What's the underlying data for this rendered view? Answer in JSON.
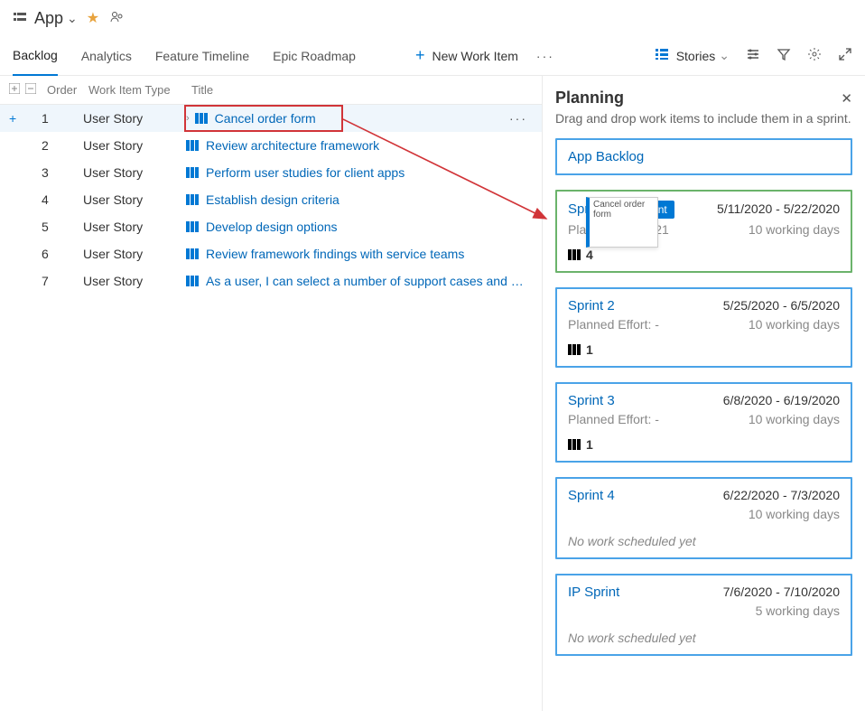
{
  "header": {
    "title": "App"
  },
  "tabs": {
    "backlog": "Backlog",
    "analytics": "Analytics",
    "feature": "Feature Timeline",
    "epic": "Epic Roadmap",
    "newWorkItem": "New Work Item",
    "storiesLabel": "Stories"
  },
  "grid": {
    "cols": {
      "order": "Order",
      "type": "Work Item Type",
      "title": "Title"
    },
    "rows": [
      {
        "order": "1",
        "type": "User Story",
        "title": "Cancel order form"
      },
      {
        "order": "2",
        "type": "User Story",
        "title": "Review architecture framework"
      },
      {
        "order": "3",
        "type": "User Story",
        "title": "Perform user studies for client apps"
      },
      {
        "order": "4",
        "type": "User Story",
        "title": "Establish design criteria"
      },
      {
        "order": "5",
        "type": "User Story",
        "title": "Develop design options"
      },
      {
        "order": "6",
        "type": "User Story",
        "title": "Review framework findings with service teams"
      },
      {
        "order": "7",
        "type": "User Story",
        "title": "As a user, I can select a number of support cases and …"
      }
    ]
  },
  "panel": {
    "title": "Planning",
    "sub": "Drag and drop work items to include them in a sprint.",
    "backlogName": "App Backlog",
    "currentBadge": "Current",
    "sprints": [
      {
        "name": "Sprint 1",
        "dates": "5/11/2020 - 5/22/2020",
        "effort": "Planned Effort: 21",
        "days": "10 working days",
        "count": "4",
        "current": true,
        "ghost": "Cancel order form"
      },
      {
        "name": "Sprint 2",
        "dates": "5/25/2020 - 6/5/2020",
        "effort": "Planned Effort: -",
        "days": "10 working days",
        "count": "1"
      },
      {
        "name": "Sprint 3",
        "dates": "6/8/2020 - 6/19/2020",
        "effort": "Planned Effort: -",
        "days": "10 working days",
        "count": "1"
      },
      {
        "name": "Sprint 4",
        "dates": "6/22/2020 - 7/3/2020",
        "days": "10 working days",
        "none": "No work scheduled yet"
      },
      {
        "name": "IP Sprint",
        "dates": "7/6/2020 - 7/10/2020",
        "days": "5 working days",
        "none": "No work scheduled yet"
      }
    ]
  }
}
